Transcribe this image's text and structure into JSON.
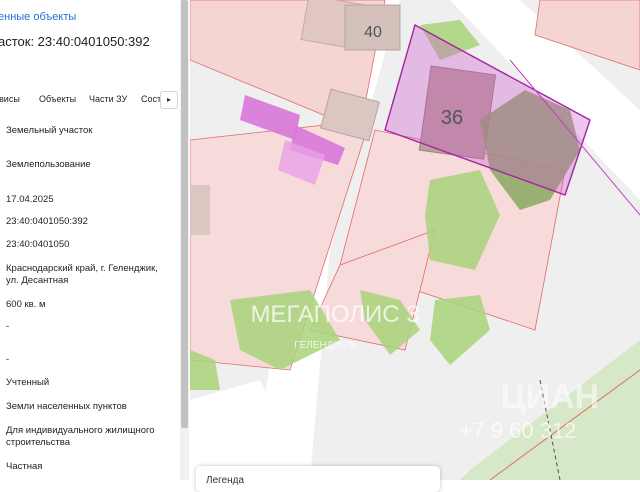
{
  "panel": {
    "link": "енные объекты",
    "title": "асток: 23:40:0401050:392",
    "tabs": [
      "рвисы",
      "Объекты",
      "Части ЗУ",
      "Сост"
    ],
    "tab_arrow": "▸",
    "rows": [
      "Земельный участок",
      "Землепользование",
      "17.04.2025",
      "23:40:0401050:392",
      "23:40:0401050",
      "Краснодарский край, г. Геленджик, ул. Десантная",
      "600 кв. м",
      "-",
      "-",
      "Учтенный",
      "Земли населенных пунктов",
      "Для индивидуального жилищного строительства",
      "Частная"
    ]
  },
  "map": {
    "house_numbers": [
      "40",
      "36"
    ],
    "watermark": {
      "brand": "МЕГАПОЛИС 3",
      "city": "ГЕЛЕНДЖИК",
      "phone": "+7 9 60 312",
      "right_brand": "ЦИАН"
    }
  },
  "bottom_bar": {
    "label": "Легенда"
  }
}
